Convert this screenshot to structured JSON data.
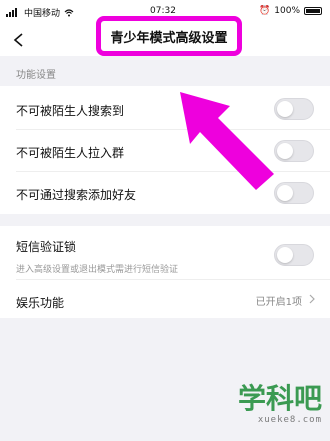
{
  "status_bar": {
    "carrier": "中国移动",
    "time": "07:32",
    "battery": "100%"
  },
  "nav": {
    "title": "青少年模式高级设置",
    "highlight_color": "#ee00dd"
  },
  "section": {
    "label": "功能设置"
  },
  "settings": {
    "items": [
      {
        "label": "不可被陌生人搜索到",
        "enabled": false
      },
      {
        "label": "不可被陌生人拉入群",
        "enabled": false
      },
      {
        "label": "不可通过搜索添加好友",
        "enabled": false
      }
    ],
    "sms_lock": {
      "label": "短信验证锁",
      "subtitle": "进入高级设置或退出模式需进行短信验证",
      "enabled": false
    },
    "entertainment": {
      "label": "娱乐功能",
      "value": "已开启1项"
    }
  },
  "watermark": {
    "main": "学科吧",
    "sub": "xueke8.com"
  }
}
